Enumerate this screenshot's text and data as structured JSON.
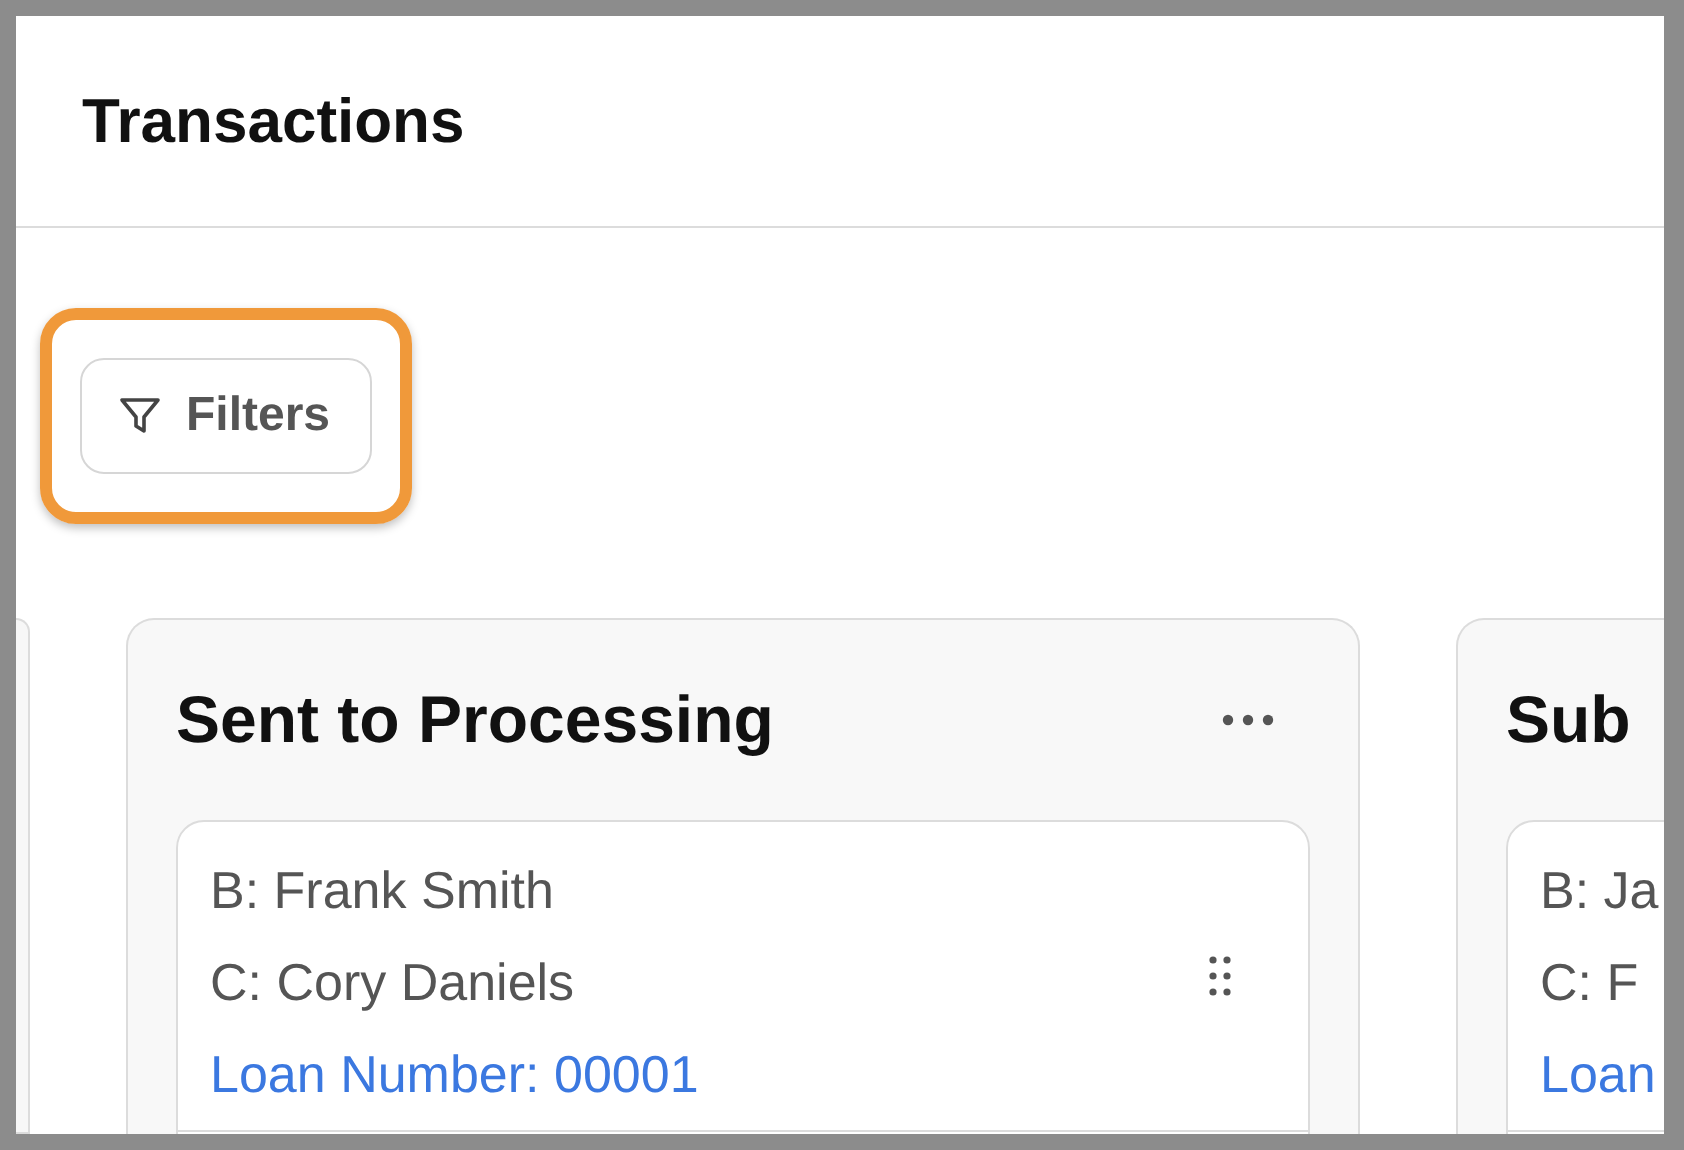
{
  "header": {
    "title": "Transactions"
  },
  "filters_button": {
    "label": "Filters",
    "highlighted": true
  },
  "columns": [
    {
      "title": "Sent to Processing",
      "show_menu": true,
      "cards": [
        {
          "borrower": "B: Frank Smith",
          "co_borrower": "C: Cory Daniels",
          "loan_number": "Loan Number: 00001",
          "show_handle": true
        }
      ]
    },
    {
      "title": "Sub",
      "cards": [
        {
          "borrower": "B: Ja",
          "co_borrower": "C: F",
          "loan_number": "Loan"
        }
      ]
    }
  ]
}
